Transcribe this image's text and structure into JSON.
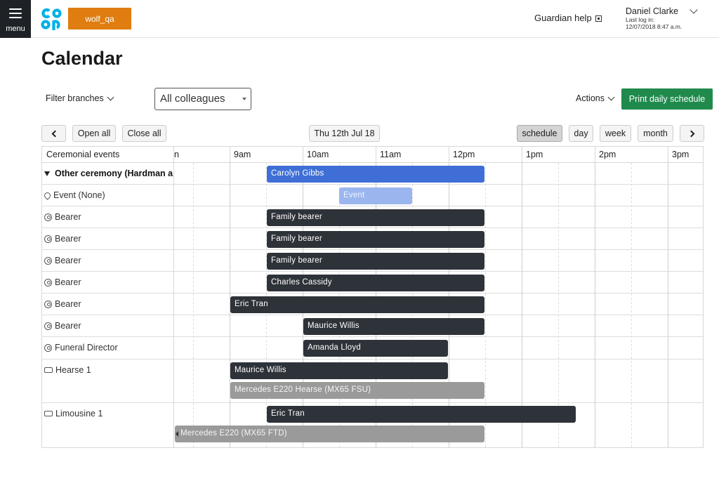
{
  "header": {
    "menu_label": "menu",
    "tenant": "wolf_qa",
    "help_label": "Guardian help",
    "user_name": "Daniel Clarke",
    "last_login_label": "Last log in:",
    "last_login_value": "12/07/2018 8:47 a.m.",
    "logo_color": "#00b1e7"
  },
  "page": {
    "title": "Calendar",
    "filter_branches_label": "Filter branches",
    "colleague_select_value": "All colleagues",
    "actions_label": "Actions",
    "print_button_label": "Print daily schedule"
  },
  "toolbar": {
    "open_all": "Open all",
    "close_all": "Close all",
    "date": "Thu 12th Jul 18",
    "views": [
      "schedule",
      "day",
      "week",
      "month"
    ],
    "active_view": "schedule"
  },
  "calendar": {
    "resource_header": "Ceremonial events",
    "time_labels": [
      "9am",
      "10am",
      "11am",
      "12pm",
      "1pm",
      "2pm",
      "3pm"
    ],
    "clipped_label": "n",
    "group_label": "Other ceremony (Hardman and",
    "rows": [
      {
        "label": "Other ceremony (Hardman and",
        "icon": "collapse-triangle-icon"
      },
      {
        "label": "Event (None)",
        "icon": "location-pin-icon"
      },
      {
        "label": "Bearer",
        "icon": "person-icon"
      },
      {
        "label": "Bearer",
        "icon": "person-icon"
      },
      {
        "label": "Bearer",
        "icon": "person-icon"
      },
      {
        "label": "Bearer",
        "icon": "person-icon"
      },
      {
        "label": "Bearer",
        "icon": "person-icon"
      },
      {
        "label": "Bearer",
        "icon": "person-icon"
      },
      {
        "label": "Funeral Director",
        "icon": "person-icon"
      },
      {
        "label": "Hearse 1",
        "icon": "vehicle-icon"
      },
      {
        "label": "Limousine 1",
        "icon": "vehicle-icon"
      }
    ],
    "events": [
      {
        "label": "Carolyn Gibbs",
        "start": "9:30",
        "end": "12:30",
        "color": "#3f6fd6"
      },
      {
        "label": "Event",
        "start": "10:30",
        "end": "11:30",
        "color": "#9bb6ee"
      },
      {
        "label": "Family bearer",
        "start": "9:30",
        "end": "12:30",
        "color": "#2e3239"
      },
      {
        "label": "Family bearer",
        "start": "9:30",
        "end": "12:30",
        "color": "#2e3239"
      },
      {
        "label": "Family bearer",
        "start": "9:30",
        "end": "12:30",
        "color": "#2e3239"
      },
      {
        "label": "Charles Cassidy",
        "start": "9:30",
        "end": "12:30",
        "color": "#2e3239"
      },
      {
        "label": "Eric Tran",
        "start": "9:00",
        "end": "12:30",
        "color": "#2e3239"
      },
      {
        "label": "Maurice Willis",
        "start": "10:00",
        "end": "12:30",
        "color": "#2e3239"
      },
      {
        "label": "Amanda Lloyd",
        "start": "10:00",
        "end": "12:00",
        "color": "#2e3239"
      },
      {
        "label": "Maurice Willis",
        "start": "9:00",
        "end": "12:00",
        "color": "#2e3239"
      },
      {
        "label": "Mercedes E220 Hearse (MX65 FSU)",
        "start": "9:00",
        "end": "12:30",
        "color": "#9a9a9a"
      },
      {
        "label": "Eric Tran",
        "start": "9:30",
        "end": "13:45",
        "color": "#2e3239"
      },
      {
        "label": "Mercedes E220 (MX65 FTD)",
        "start": "",
        "end": "12:30",
        "color": "#9a9a9a"
      }
    ]
  }
}
